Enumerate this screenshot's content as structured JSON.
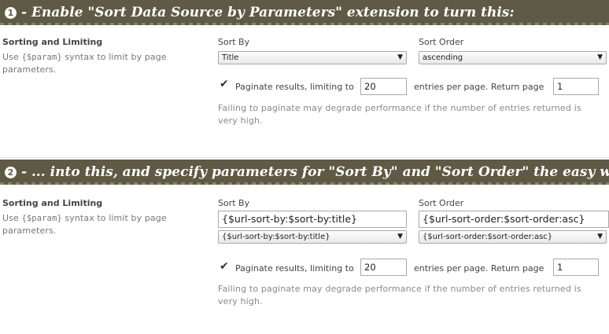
{
  "banners": {
    "one": {
      "num": "1",
      "text": "- Enable \"Sort Data Source by Parameters\" extension to turn this:"
    },
    "two": {
      "num": "2",
      "text": "- ... into this, and specify parameters for \"Sort By\" and \"Sort Order\" the easy way:"
    }
  },
  "section1": {
    "title": "Sorting and Limiting",
    "desc_prefix": "Use ",
    "desc_code": "{$param}",
    "desc_suffix": " syntax to limit by page parameters.",
    "sort_by_label": "Sort By",
    "sort_by_value": "Title",
    "sort_order_label": "Sort Order",
    "sort_order_value": "ascending",
    "paginate_checked": true,
    "paginate_text": "Paginate results, limiting to",
    "limit_value": "20",
    "entries_text": "entries per page. Return page",
    "page_value": "1",
    "help": "Failing to paginate may degrade performance if the number of entries returned is very high."
  },
  "section2": {
    "title": "Sorting and Limiting",
    "desc_prefix": "Use ",
    "desc_code": "{$param}",
    "desc_suffix": " syntax to limit by page parameters.",
    "sort_by_label": "Sort By",
    "sort_by_input": "{$url-sort-by:$sort-by:title}",
    "sort_by_select": "{$url-sort-by:$sort-by:title}",
    "sort_order_label": "Sort Order",
    "sort_order_input": "{$url-sort-order:$sort-order:asc}",
    "sort_order_select": "{$url-sort-order:$sort-order:asc}",
    "paginate_checked": true,
    "paginate_text": "Paginate results, limiting to",
    "limit_value": "20",
    "entries_text": "entries per page. Return page",
    "page_value": "1",
    "help": "Failing to paginate may degrade performance if the number of entries returned is very high."
  },
  "icons": {
    "checkmark": "✔",
    "dropdown_arrow": "▼"
  }
}
